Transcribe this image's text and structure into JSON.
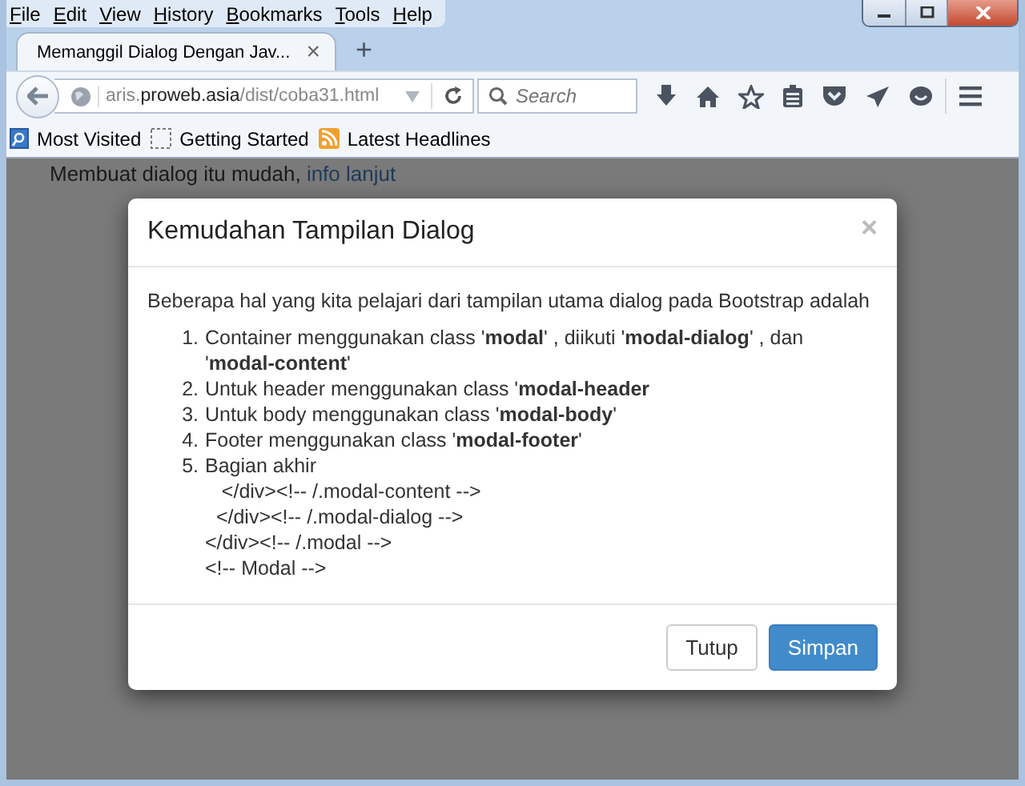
{
  "menu": [
    "File",
    "Edit",
    "View",
    "History",
    "Bookmarks",
    "Tools",
    "Help"
  ],
  "tabs": [
    {
      "label": "Memanggil Dialog Dengan Jav...",
      "close": "×",
      "selected": true
    }
  ],
  "new_tab": "+",
  "address": {
    "pre": "aris.",
    "domain": "proweb.asia",
    "path": "/dist/coba31.html"
  },
  "search": {
    "placeholder": "Search"
  },
  "bookmarks": [
    {
      "label": "Most Visited",
      "kind": "folder"
    },
    {
      "label": "Getting Started",
      "kind": "blank"
    },
    {
      "label": "Latest Headlines",
      "kind": "feed"
    }
  ],
  "page": {
    "text": "Membuat dialog itu mudah,",
    "link": "info lanjut"
  },
  "modal": {
    "title": "Kemudahan Tampilan Dialog",
    "close": "×",
    "intro": "Beberapa hal yang kita pelajari dari tampilan utama dialog pada Bootstrap adalah",
    "items": [
      {
        "number": "1.",
        "text": "Container menggunakan class '**modal**' , diikuti '**modal-dialog**' , dan '**modal-content**'"
      },
      {
        "number": "2.",
        "text": "Untuk header menggunakan class '**modal-header**"
      },
      {
        "number": "3.",
        "text": "Untuk body menggunakan class '**modal-body**'"
      },
      {
        "number": "4.",
        "text": "Footer menggunakan class '**modal-footer**'"
      },
      {
        "number": "5.",
        "text": "Bagian akhir",
        "code": [
          "   </div><!-- /.modal-content -->",
          "  </div><!-- /.modal-dialog -->",
          "</div><!-- /.modal -->",
          "<!-- Modal -->"
        ]
      }
    ],
    "buttons": [
      {
        "label": "Tutup",
        "kind": "default"
      },
      {
        "label": "Simpan",
        "kind": "primary"
      }
    ]
  }
}
